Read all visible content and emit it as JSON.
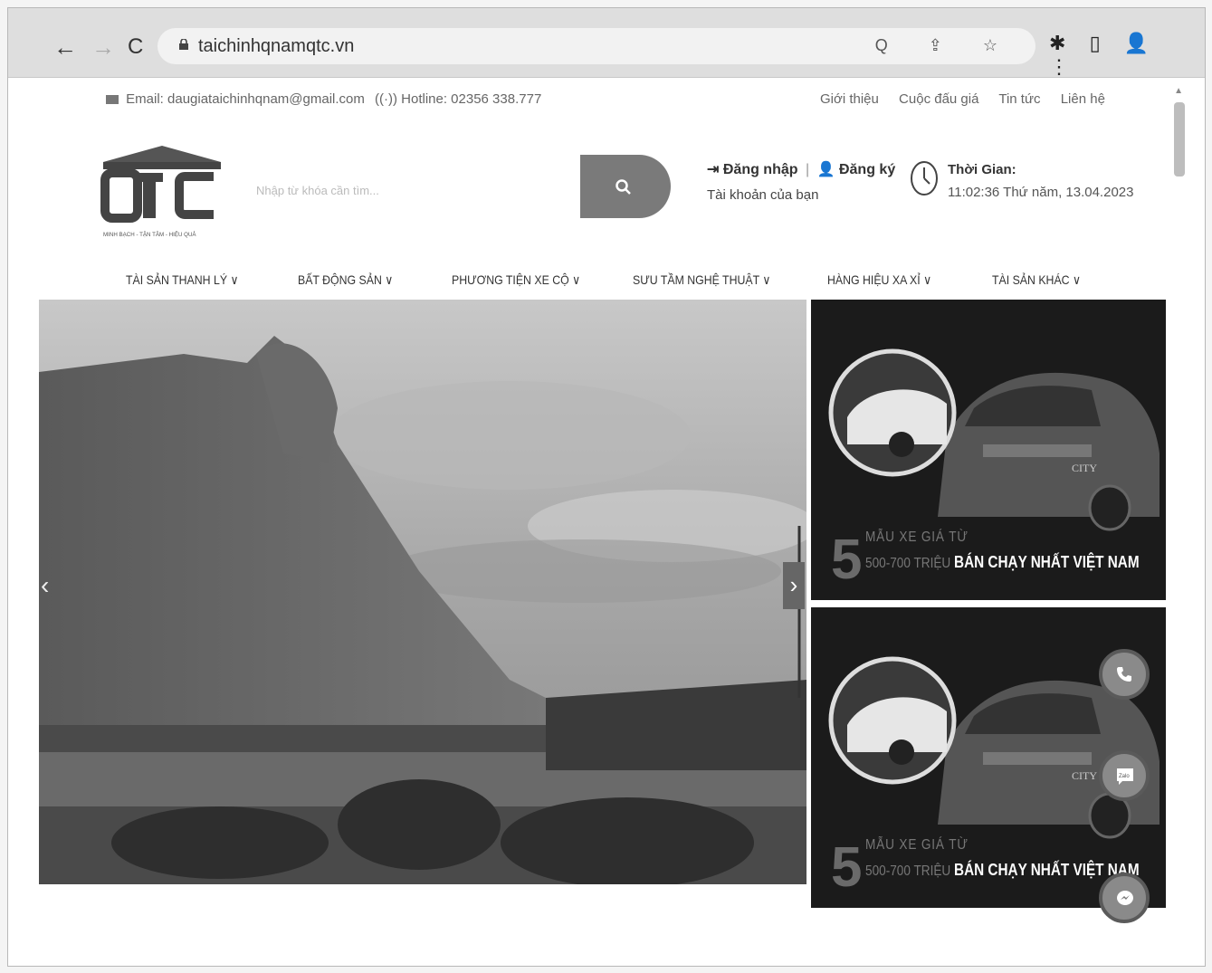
{
  "browser": {
    "url": "taichinhqnamqtc.vn",
    "nav_back": "←",
    "nav_forward": "→",
    "nav_reload": "C",
    "url_actions": "Q ⇪ ☆",
    "extensions": [
      "✱",
      "▯",
      "⋮"
    ]
  },
  "topbar": {
    "email": "Email: daugiataichinhqnam@gmail.com",
    "hotline": "Hotline: 02356 338.777",
    "links": [
      "Giới thiệu",
      "Cuộc đấu giá",
      "Tin tức",
      "Liên hệ"
    ]
  },
  "header": {
    "logo_letters": "QTC",
    "logo_tagline": "MINH BẠCH - TẬN TÂM - HIỆU QUẢ",
    "search_placeholder": "Nhập từ khóa cần tìm...",
    "login": "Đăng nhập",
    "register": "Đăng ký",
    "account_label": "Tài khoản của bạn",
    "time_label": "Thời Gian:",
    "time_value": "11:02:36 Thứ năm, 13.04.2023"
  },
  "menu": [
    "TÀI SẢN THANH LÝ ∨",
    "BẤT ĐỘNG SẢN ∨",
    "PHƯƠNG TIỆN XE CỘ ∨",
    "SƯU TẦM NGHỆ THUẬT ∨",
    "HÀNG HIỆU XA XỈ ∨",
    "TÀI SẢN KHÁC ∨"
  ],
  "banners": [
    {
      "number": "5",
      "line1": "MẪU XE GIÁ TỪ",
      "line2_gray": "500-700 TRIỆU ",
      "line2_white": "BÁN CHẠY NHẤT VIỆT NAM",
      "car_badge": "CITY"
    },
    {
      "number": "5",
      "line1": "MẪU XE GIÁ TỪ",
      "line2_gray": "500-700 TRIỆU ",
      "line2_white": "BÁN CHẠY NHẤT VIỆT NAM",
      "car_badge": "CITY"
    }
  ],
  "hero": {
    "prev": "‹",
    "next": "›"
  },
  "floating": {
    "zalo_label": "Zalo"
  }
}
